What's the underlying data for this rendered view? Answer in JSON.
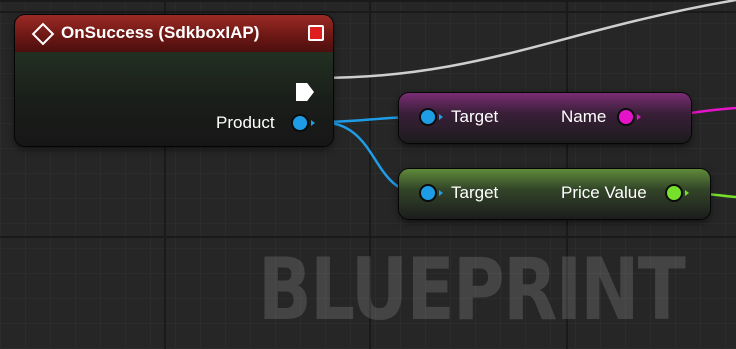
{
  "event_node": {
    "title": "OnSuccess (SdkboxIAP)",
    "output_pin_label": "Product"
  },
  "name_node": {
    "input_label": "Target",
    "output_label": "Name"
  },
  "price_node": {
    "input_label": "Target",
    "output_label": "Price Value"
  },
  "watermark": "BLUEPRINT",
  "colors": {
    "event_header": "#8b221d",
    "object_pin": "#1e9de6",
    "string_pin": "#e614c8",
    "float_pin": "#76e02a",
    "exec_wire": "#cfcfcf"
  },
  "icons": [
    "event-diamond-icon",
    "close-icon",
    "exec-pin-icon"
  ]
}
